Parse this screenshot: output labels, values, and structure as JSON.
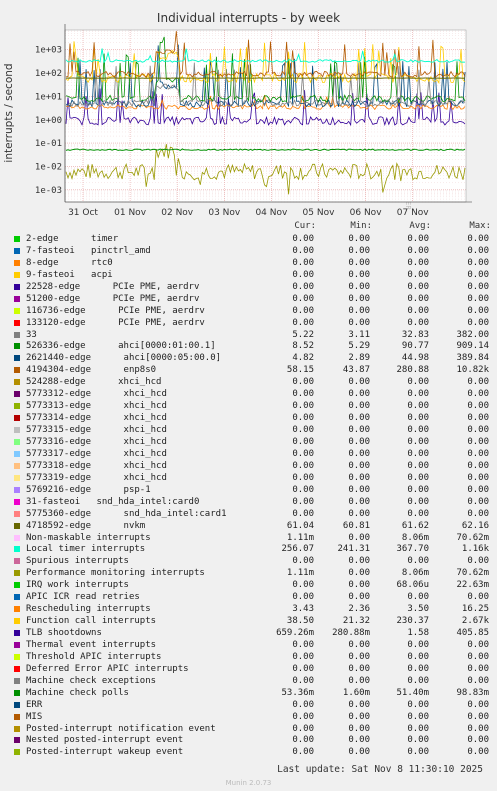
{
  "title": "Individual interrupts - by week",
  "ylabel": "interrupts / second",
  "side_text": "RRDTOOL / TOBI OETIKER",
  "footer": "Last update:  Sat Nov  8 11:30:10 2025",
  "munin": "Munin 2.0.73",
  "legend_headers": [
    "Cur:",
    "Min:",
    "Avg:",
    "Max:"
  ],
  "chart_data": {
    "type": "line",
    "title": "Individual interrupts - by week",
    "ylabel": "interrupts / second",
    "yscale": "log",
    "ylim": [
      0.0003,
      7000
    ],
    "yticks": [
      "1e-03",
      "1e-02",
      "1e-01",
      "1e+00",
      "1e+01",
      "1e+02",
      "1e+03"
    ],
    "xticks": [
      "31 Oct",
      "01 Nov",
      "02 Nov",
      "03 Nov",
      "04 Nov",
      "05 Nov",
      "06 Nov",
      "07 Nov"
    ],
    "grid": true,
    "series": [
      {
        "name": "2-edge      timer",
        "color": "#00cc00",
        "cur": "0.00",
        "min": "0.00",
        "avg": "0.00",
        "max": "0.00"
      },
      {
        "name": "7-fasteoi   pinctrl_amd",
        "color": "#0066b3",
        "cur": "0.00",
        "min": "0.00",
        "avg": "0.00",
        "max": "0.00"
      },
      {
        "name": "8-edge      rtc0",
        "color": "#ff8000",
        "cur": "0.00",
        "min": "0.00",
        "avg": "0.00",
        "max": "0.00"
      },
      {
        "name": "9-fasteoi   acpi",
        "color": "#ffcc00",
        "cur": "0.00",
        "min": "0.00",
        "avg": "0.00",
        "max": "0.00"
      },
      {
        "name": "22528-edge      PCIe PME, aerdrv",
        "color": "#330099",
        "cur": "0.00",
        "min": "0.00",
        "avg": "0.00",
        "max": "0.00"
      },
      {
        "name": "51200-edge      PCIe PME, aerdrv",
        "color": "#990099",
        "cur": "0.00",
        "min": "0.00",
        "avg": "0.00",
        "max": "0.00"
      },
      {
        "name": "116736-edge      PCIe PME, aerdrv",
        "color": "#ccff00",
        "cur": "0.00",
        "min": "0.00",
        "avg": "0.00",
        "max": "0.00"
      },
      {
        "name": "133120-edge      PCIe PME, aerdrv",
        "color": "#ff0000",
        "cur": "0.00",
        "min": "0.00",
        "avg": "0.00",
        "max": "0.00"
      },
      {
        "name": "33",
        "color": "#808080",
        "cur": "5.22",
        "min": "3.11",
        "avg": "32.83",
        "max": "382.00"
      },
      {
        "name": "526336-edge      ahci[0000:01:00.1]",
        "color": "#008f00",
        "cur": "8.52",
        "min": "5.29",
        "avg": "90.77",
        "max": "909.14"
      },
      {
        "name": "2621440-edge      ahci[0000:05:00.0]",
        "color": "#00487d",
        "cur": "4.82",
        "min": "2.89",
        "avg": "44.98",
        "max": "389.84"
      },
      {
        "name": "4194304-edge      enp8s0",
        "color": "#b35a00",
        "cur": "58.15",
        "min": "43.87",
        "avg": "280.88",
        "max": "10.82k"
      },
      {
        "name": "524288-edge      xhci_hcd",
        "color": "#b38f00",
        "cur": "0.00",
        "min": "0.00",
        "avg": "0.00",
        "max": "0.00"
      },
      {
        "name": "5773312-edge      xhci_hcd",
        "color": "#6b006b",
        "cur": "0.00",
        "min": "0.00",
        "avg": "0.00",
        "max": "0.00"
      },
      {
        "name": "5773313-edge      xhci_hcd",
        "color": "#8fb300",
        "cur": "0.00",
        "min": "0.00",
        "avg": "0.00",
        "max": "0.00"
      },
      {
        "name": "5773314-edge      xhci_hcd",
        "color": "#b30000",
        "cur": "0.00",
        "min": "0.00",
        "avg": "0.00",
        "max": "0.00"
      },
      {
        "name": "5773315-edge      xhci_hcd",
        "color": "#bebebe",
        "cur": "0.00",
        "min": "0.00",
        "avg": "0.00",
        "max": "0.00"
      },
      {
        "name": "5773316-edge      xhci_hcd",
        "color": "#80ff80",
        "cur": "0.00",
        "min": "0.00",
        "avg": "0.00",
        "max": "0.00"
      },
      {
        "name": "5773317-edge      xhci_hcd",
        "color": "#80c9ff",
        "cur": "0.00",
        "min": "0.00",
        "avg": "0.00",
        "max": "0.00"
      },
      {
        "name": "5773318-edge      xhci_hcd",
        "color": "#ffc080",
        "cur": "0.00",
        "min": "0.00",
        "avg": "0.00",
        "max": "0.00"
      },
      {
        "name": "5773319-edge      xhci_hcd",
        "color": "#ffe680",
        "cur": "0.00",
        "min": "0.00",
        "avg": "0.00",
        "max": "0.00"
      },
      {
        "name": "5769216-edge      psp-1",
        "color": "#aa80ff",
        "cur": "0.00",
        "min": "0.00",
        "avg": "0.00",
        "max": "0.00"
      },
      {
        "name": "31-fasteoi   snd_hda_intel:card0",
        "color": "#ee00cc",
        "cur": "0.00",
        "min": "0.00",
        "avg": "0.00",
        "max": "0.00"
      },
      {
        "name": "5775360-edge      snd_hda_intel:card1",
        "color": "#ff8080",
        "cur": "0.00",
        "min": "0.00",
        "avg": "0.00",
        "max": "0.00"
      },
      {
        "name": "4718592-edge      nvkm",
        "color": "#666600",
        "cur": "61.04",
        "min": "60.81",
        "avg": "61.62",
        "max": "62.16"
      },
      {
        "name": "Non-maskable interrupts",
        "color": "#ffbfff",
        "cur": "1.11m",
        "min": "0.00",
        "avg": "8.06m",
        "max": "70.62m"
      },
      {
        "name": "Local timer interrupts",
        "color": "#00ffcc",
        "cur": "256.07",
        "min": "241.31",
        "avg": "367.70",
        "max": "1.16k"
      },
      {
        "name": "Spurious interrupts",
        "color": "#cc6699",
        "cur": "0.00",
        "min": "0.00",
        "avg": "0.00",
        "max": "0.00"
      },
      {
        "name": "Performance monitoring interrupts",
        "color": "#999900",
        "cur": "1.11m",
        "min": "0.00",
        "avg": "8.06m",
        "max": "70.62m"
      },
      {
        "name": "IRQ work interrupts",
        "color": "#00cc00",
        "cur": "0.00",
        "min": "0.00",
        "avg": "68.06u",
        "max": "22.63m"
      },
      {
        "name": "APIC ICR read retries",
        "color": "#0066b3",
        "cur": "0.00",
        "min": "0.00",
        "avg": "0.00",
        "max": "0.00"
      },
      {
        "name": "Rescheduling interrupts",
        "color": "#ff8000",
        "cur": "3.43",
        "min": "2.36",
        "avg": "3.50",
        "max": "16.25"
      },
      {
        "name": "Function call interrupts",
        "color": "#ffcc00",
        "cur": "38.50",
        "min": "21.32",
        "avg": "230.37",
        "max": "2.67k"
      },
      {
        "name": "TLB shootdowns",
        "color": "#330099",
        "cur": "659.26m",
        "min": "280.88m",
        "avg": "1.58",
        "max": "405.85"
      },
      {
        "name": "Thermal event interrupts",
        "color": "#990099",
        "cur": "0.00",
        "min": "0.00",
        "avg": "0.00",
        "max": "0.00"
      },
      {
        "name": "Threshold APIC interrupts",
        "color": "#ccff00",
        "cur": "0.00",
        "min": "0.00",
        "avg": "0.00",
        "max": "0.00"
      },
      {
        "name": "Deferred Error APIC interrupts",
        "color": "#ff0000",
        "cur": "0.00",
        "min": "0.00",
        "avg": "0.00",
        "max": "0.00"
      },
      {
        "name": "Machine check exceptions",
        "color": "#808080",
        "cur": "0.00",
        "min": "0.00",
        "avg": "0.00",
        "max": "0.00"
      },
      {
        "name": "Machine check polls",
        "color": "#008f00",
        "cur": "53.36m",
        "min": "1.60m",
        "avg": "51.40m",
        "max": "98.83m"
      },
      {
        "name": "ERR",
        "color": "#00487d",
        "cur": "0.00",
        "min": "0.00",
        "avg": "0.00",
        "max": "0.00"
      },
      {
        "name": "MIS",
        "color": "#b35a00",
        "cur": "0.00",
        "min": "0.00",
        "avg": "0.00",
        "max": "0.00"
      },
      {
        "name": "Posted-interrupt notification event",
        "color": "#b38f00",
        "cur": "0.00",
        "min": "0.00",
        "avg": "0.00",
        "max": "0.00"
      },
      {
        "name": "Nested posted-interrupt event",
        "color": "#6b006b",
        "cur": "0.00",
        "min": "0.00",
        "avg": "0.00",
        "max": "0.00"
      },
      {
        "name": "Posted-interrupt wakeup event",
        "color": "#8fb300",
        "cur": "0.00",
        "min": "0.00",
        "avg": "0.00",
        "max": "0.00"
      }
    ]
  }
}
